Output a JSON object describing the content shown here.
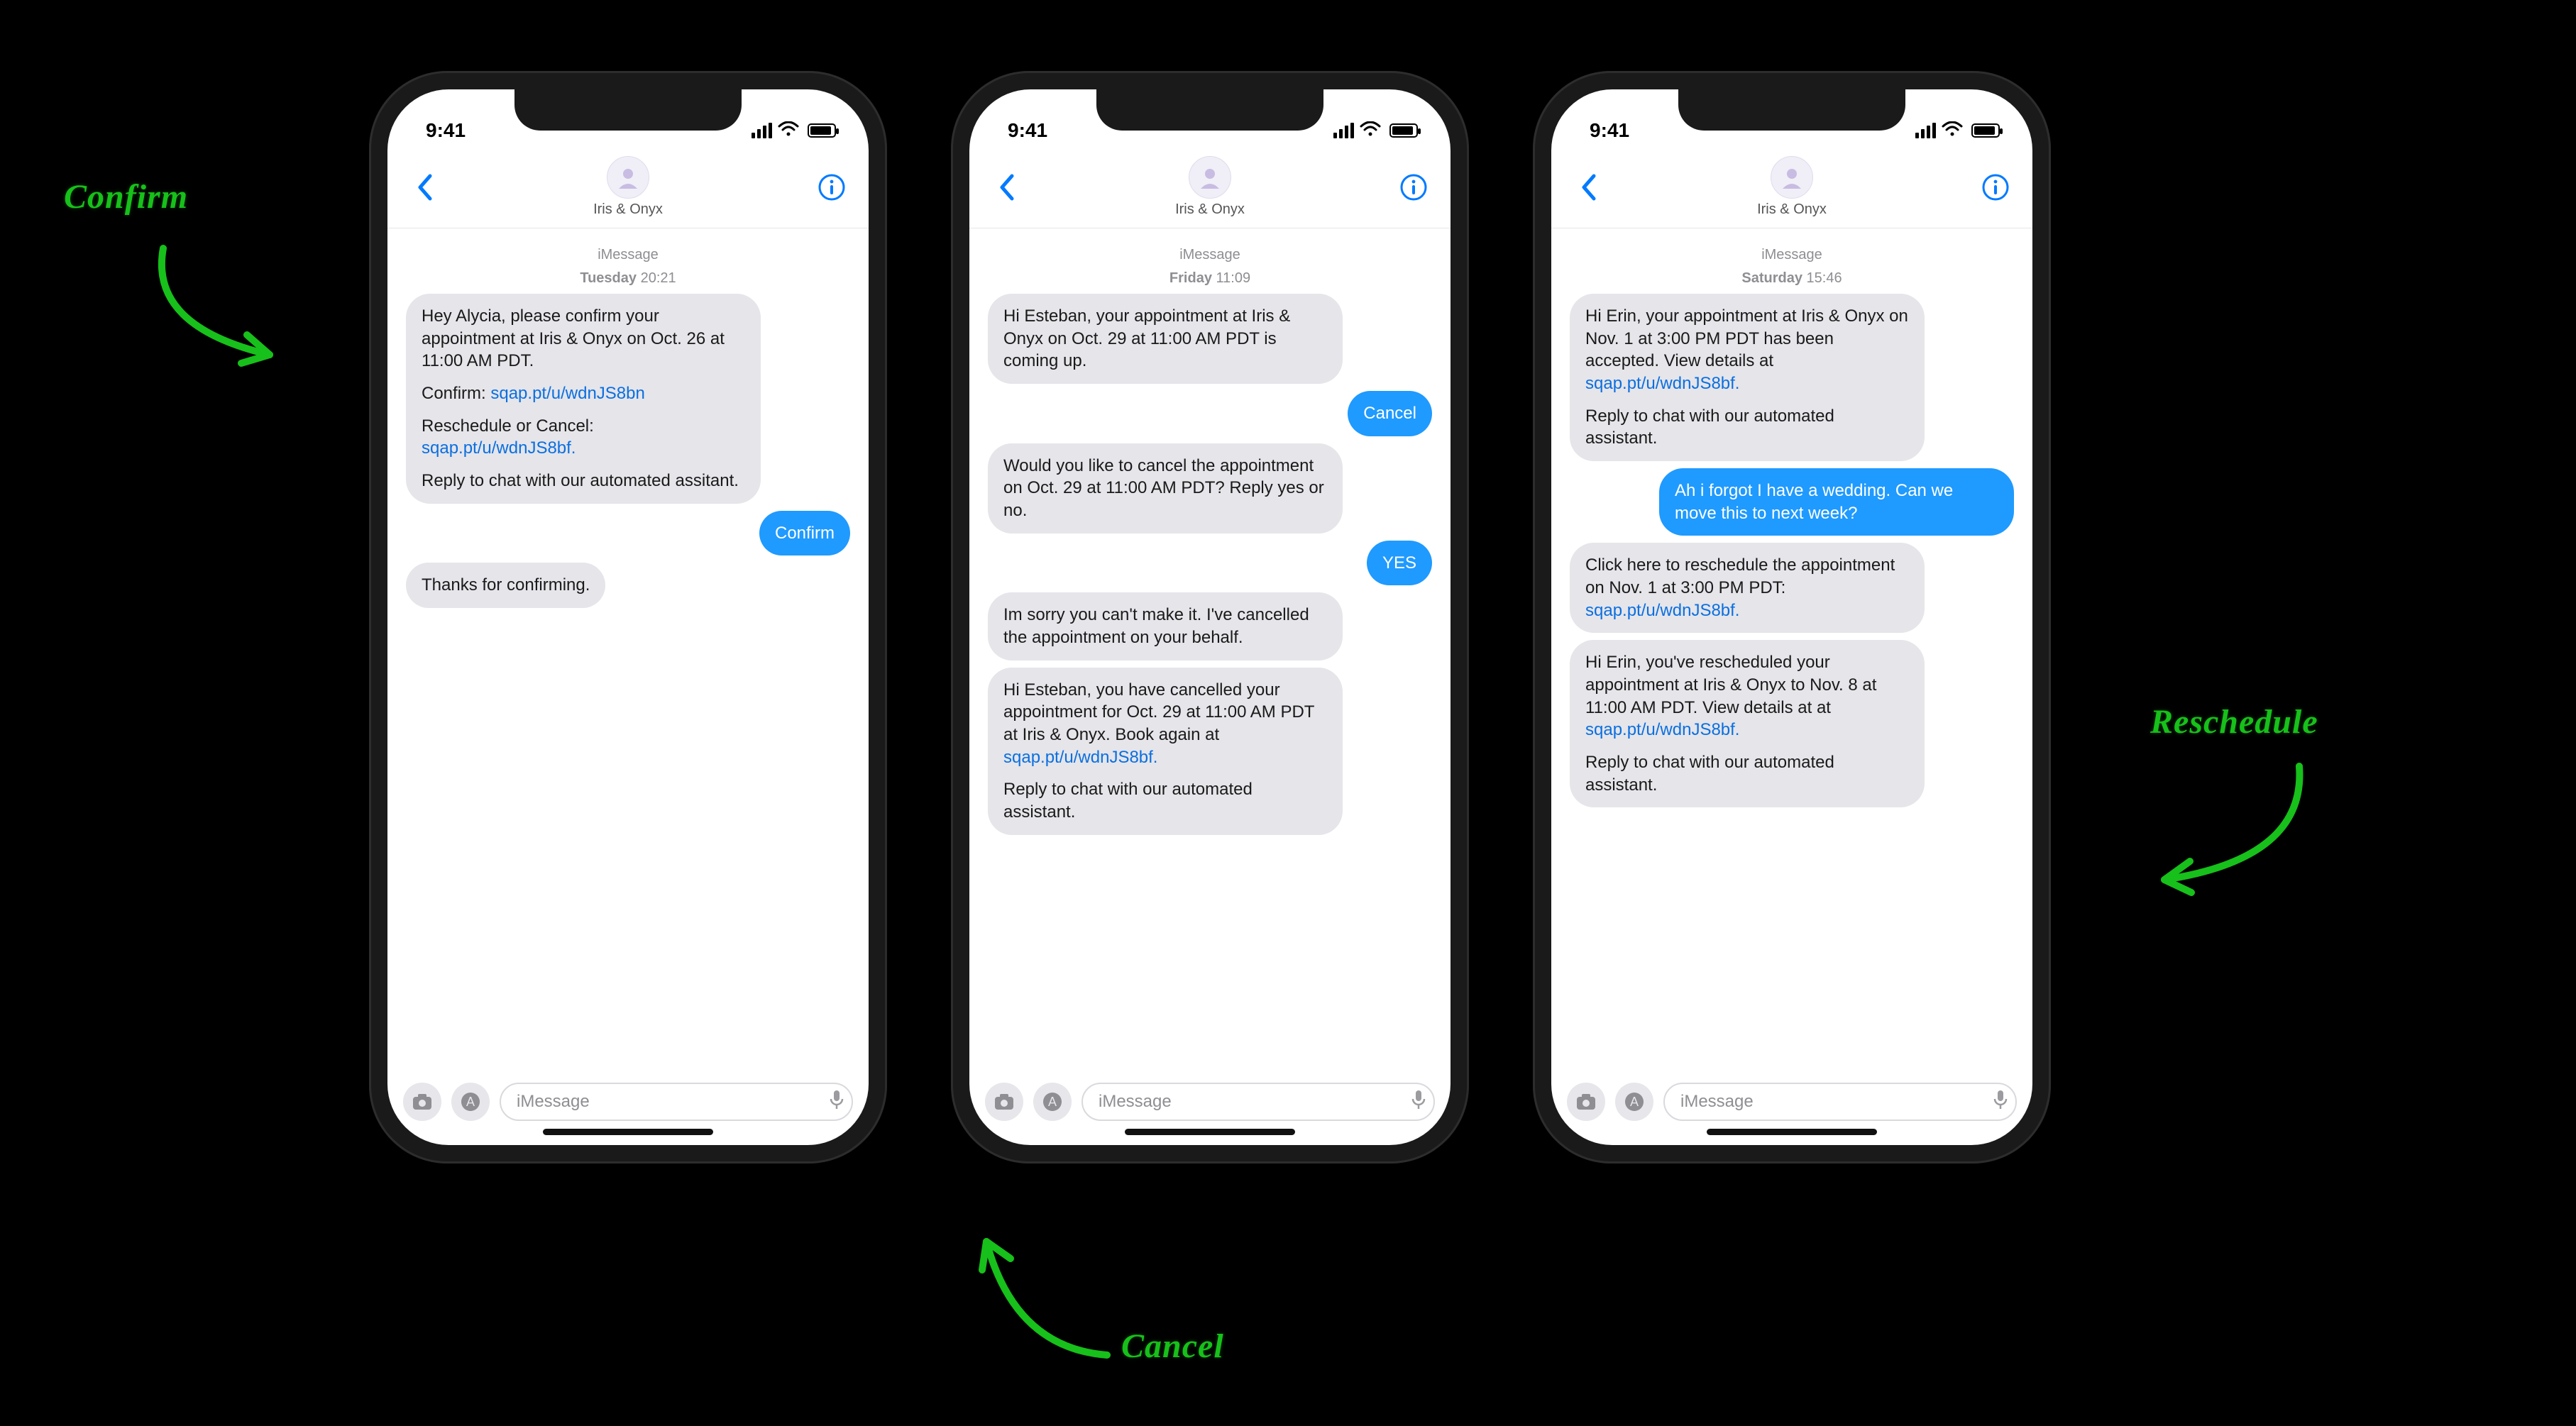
{
  "annotations": {
    "confirm": "Confirm",
    "cancel": "Cancel",
    "reschedule": "Reschedule"
  },
  "common": {
    "status_time": "9:41",
    "contact_name": "Iris & Onyx",
    "imessage_label": "iMessage",
    "input_placeholder": "iMessage"
  },
  "phones": [
    {
      "id": "confirm",
      "timestamp": {
        "day": "Tuesday",
        "time": "20:21"
      },
      "messages": [
        {
          "dir": "in",
          "paragraphs": [
            [
              {
                "t": "Hey Alycia, please confirm your appointment at Iris & Onyx on Oct. 26 at 11:00 AM PDT."
              }
            ],
            [
              {
                "t": "Confirm: "
              },
              {
                "t": "sqap.pt/u/wdnJS8bn",
                "link": true
              }
            ],
            [
              {
                "t": "Reschedule or Cancel:\n"
              },
              {
                "t": "sqap.pt/u/wdnJS8bf.",
                "link": true
              }
            ],
            [
              {
                "t": "Reply to chat with our automated assitant."
              }
            ]
          ]
        },
        {
          "dir": "out",
          "paragraphs": [
            [
              {
                "t": "Confirm"
              }
            ]
          ]
        },
        {
          "dir": "in",
          "paragraphs": [
            [
              {
                "t": "Thanks for confirming."
              }
            ]
          ]
        }
      ]
    },
    {
      "id": "cancel",
      "timestamp": {
        "day": "Friday",
        "time": "11:09"
      },
      "messages": [
        {
          "dir": "in",
          "paragraphs": [
            [
              {
                "t": "Hi Esteban, your appointment at Iris & Onyx on Oct. 29 at 11:00 AM PDT is coming up."
              }
            ]
          ]
        },
        {
          "dir": "out",
          "paragraphs": [
            [
              {
                "t": "Cancel"
              }
            ]
          ]
        },
        {
          "dir": "in",
          "paragraphs": [
            [
              {
                "t": "Would you like to cancel the appointment on Oct. 29 at 11:00 AM PDT? Reply yes or no."
              }
            ]
          ]
        },
        {
          "dir": "out",
          "paragraphs": [
            [
              {
                "t": "YES"
              }
            ]
          ]
        },
        {
          "dir": "in",
          "paragraphs": [
            [
              {
                "t": "Im sorry you can't make it. I've cancelled the appointment on your behalf."
              }
            ]
          ]
        },
        {
          "dir": "in",
          "paragraphs": [
            [
              {
                "t": "Hi Esteban, you have cancelled your appointment for Oct. 29 at 11:00 AM PDT at Iris & Onyx. Book again at "
              },
              {
                "t": "sqap.pt/u/wdnJS8bf.",
                "link": true
              }
            ],
            [
              {
                "t": "Reply to chat with our automated assistant."
              }
            ]
          ]
        }
      ]
    },
    {
      "id": "reschedule",
      "timestamp": {
        "day": "Saturday",
        "time": "15:46"
      },
      "messages": [
        {
          "dir": "in",
          "paragraphs": [
            [
              {
                "t": "Hi Erin, your appointment at Iris & Onyx on Nov. 1 at 3:00 PM PDT has been accepted. View details at "
              },
              {
                "t": "sqap.pt/u/wdnJS8bf.",
                "link": true
              }
            ],
            [
              {
                "t": "Reply to chat with our automated assistant."
              }
            ]
          ]
        },
        {
          "dir": "out",
          "paragraphs": [
            [
              {
                "t": "Ah i forgot I have a wedding. Can we move this to next week?"
              }
            ]
          ]
        },
        {
          "dir": "in",
          "paragraphs": [
            [
              {
                "t": "Click here to reschedule the appointment on Nov. 1 at 3:00 PM PDT: "
              },
              {
                "t": "sqap.pt/u/wdnJS8bf.",
                "link": true
              }
            ]
          ]
        },
        {
          "dir": "in",
          "paragraphs": [
            [
              {
                "t": "Hi Erin, you've rescheduled your appointment at Iris & Onyx to Nov. 8 at 11:00 AM PDT. View details at at "
              },
              {
                "t": "sqap.pt/u/wdnJS8bf.",
                "link": true
              }
            ],
            [
              {
                "t": "Reply to chat with our automated assistant."
              }
            ]
          ]
        }
      ]
    }
  ]
}
